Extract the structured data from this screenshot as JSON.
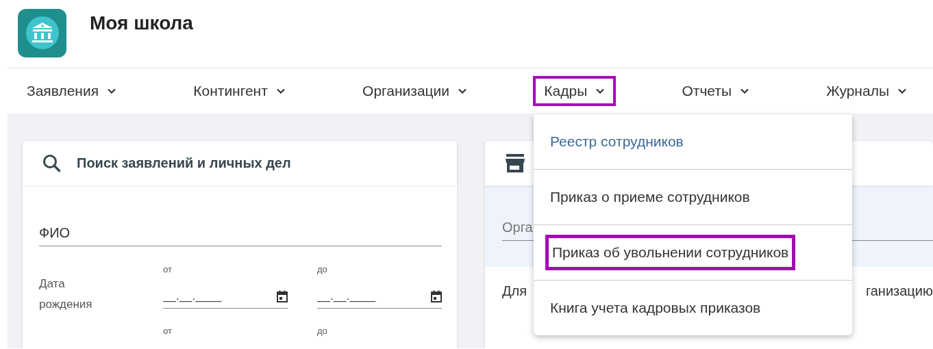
{
  "app": {
    "title": "Моя школа"
  },
  "nav": [
    {
      "label": "Заявления",
      "selected": false
    },
    {
      "label": "Контингент",
      "selected": false
    },
    {
      "label": "Организации",
      "selected": false
    },
    {
      "label": "Кадры",
      "selected": true
    },
    {
      "label": "Отчеты",
      "selected": false
    },
    {
      "label": "Журналы",
      "selected": false
    }
  ],
  "dropdown": {
    "items": [
      {
        "label": "Реестр сотрудников",
        "current": true,
        "selected": false
      },
      {
        "label": "Приказ о приеме сотрудников",
        "current": false,
        "selected": false
      },
      {
        "label": "Приказ об увольнении сотрудников",
        "current": false,
        "selected": true
      },
      {
        "label": "Книга учета кадровых приказов",
        "current": false,
        "selected": false
      }
    ]
  },
  "search_card": {
    "title": "Поиск заявлений и личных дел",
    "fio_field": {
      "placeholder": "ФИО"
    },
    "date_rows": [
      {
        "label": "Дата рождения",
        "from": {
          "caption": "от",
          "placeholder": "__.__.____"
        },
        "to": {
          "caption": "до",
          "placeholder": "__.__.____"
        }
      },
      {
        "from": {
          "caption": "от"
        },
        "to": {
          "caption": "до"
        }
      }
    ]
  },
  "org_card": {
    "field": {
      "placeholder": "Орга"
    },
    "text_start": "Для",
    "text_end": "ганизацию"
  }
}
